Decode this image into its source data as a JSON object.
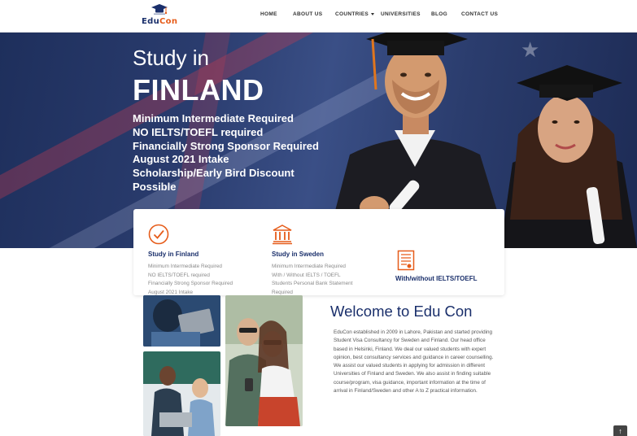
{
  "brand": {
    "logo_part1": "Edu",
    "logo_part2": "Con",
    "colors": {
      "navy": "#1a2f6b",
      "orange": "#e65c1a"
    }
  },
  "nav": {
    "items": [
      {
        "label": "HOME"
      },
      {
        "label": "ABOUT US"
      },
      {
        "label": "COUNTRIES",
        "has_dropdown": true
      },
      {
        "label": "UNIVERSITIES"
      },
      {
        "label": "BLOG"
      },
      {
        "label": "CONTACT US"
      }
    ]
  },
  "hero": {
    "title_line1": "Study in",
    "title_line2": "FINLAND",
    "lines": [
      "Minimum Intermediate Required",
      "NO IELTS/TOEFL required",
      "Financially Strong Sponsor Required",
      "August 2021 Intake",
      "Scholarship/Early Bird Discount",
      "Possible"
    ]
  },
  "cards": [
    {
      "icon": "checkmark-circle-icon",
      "title": "Study in Finland",
      "lines": [
        "Minimum Intermediate Required",
        "NO IELTS/TOEFL required",
        "Financially Strong Sponsor Required",
        "August 2021 Intake"
      ]
    },
    {
      "icon": "bank-building-icon",
      "title": "Study in Sweden",
      "lines": [
        "Minimum Intermediate Required",
        "With / Without IELTS / TOEFL",
        "Students Personal Bank Statement",
        "Required"
      ]
    },
    {
      "icon": "certificate-document-icon",
      "title": "With/without IELTS/TOEFL"
    }
  ],
  "welcome": {
    "title": "Welcome to Edu Con",
    "paragraph": "EduCon established in 2009 in Lahore, Pakistan and started providing Student Visa Consultancy for Sweden and Finland. Our head office based in Helsinki, Finland. We deal our valued students with expert opinion, best consultancy services and guidance in career counselling. We assist our valued students in applying for admission in different Universities of Finland and Sweden. We also assist in finding suitable course/program, visa guidance, important information at the time of arrival in Finland/Sweden and other A to Z practical information."
  },
  "scroll_top": {
    "icon": "arrow-up-icon",
    "glyph": "↑"
  }
}
